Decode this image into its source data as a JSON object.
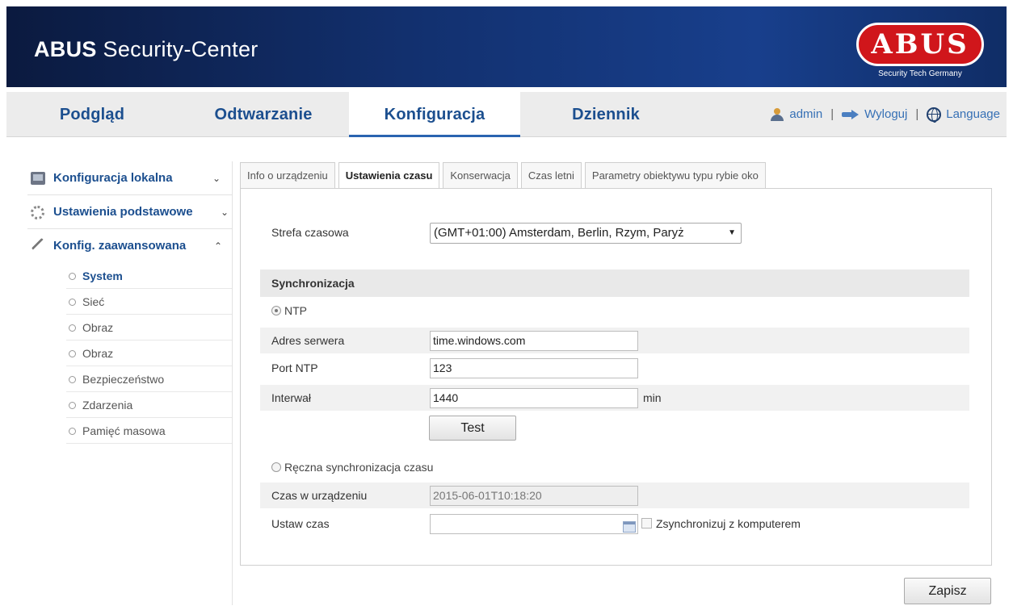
{
  "header": {
    "title_bold": "ABUS",
    "title_rest": " Security-Center",
    "logo_text": "ABUS",
    "logo_tagline": "Security Tech Germany"
  },
  "nav": {
    "tabs": [
      "Podgląd",
      "Odtwarzanie",
      "Konfiguracja",
      "Dziennik"
    ],
    "active_index": 2,
    "user": "admin",
    "logout": "Wyloguj",
    "language": "Language",
    "separator": "|"
  },
  "sidebar": {
    "items": [
      {
        "label": "Konfiguracja lokalna",
        "chevron": "⌄"
      },
      {
        "label": "Ustawienia podstawowe",
        "chevron": "⌄"
      },
      {
        "label": "Konfig. zaawansowana",
        "chevron": "⌃"
      }
    ],
    "subitems": [
      "System",
      "Sieć",
      "Obraz",
      "Obraz",
      "Bezpieczeństwo",
      "Zdarzenia",
      "Pamięć masowa"
    ],
    "active_sub": 0
  },
  "tabs": [
    "Info o urządzeniu",
    "Ustawienia czasu",
    "Konserwacja",
    "Czas letni",
    "Parametry obiektywu typu rybie oko"
  ],
  "active_tab": 1,
  "form": {
    "timezone_label": "Strefa czasowa",
    "timezone_value": "(GMT+01:00) Amsterdam, Berlin, Rzym, Paryż",
    "sync_header": "Synchronizacja",
    "ntp_label": "NTP",
    "server_label": "Adres serwera",
    "server_value": "time.windows.com",
    "port_label": "Port NTP",
    "port_value": "123",
    "interval_label": "Interwał",
    "interval_value": "1440",
    "interval_unit": "min",
    "test_button": "Test",
    "manual_label": "Ręczna synchronizacja czasu",
    "device_time_label": "Czas w urządzeniu",
    "device_time_value": "2015-06-01T10:18:20",
    "set_time_label": "Ustaw czas",
    "set_time_value": "",
    "sync_pc_label": "Zsynchronizuj z komputerem"
  },
  "save_button": "Zapisz",
  "colors": {
    "brand_red": "#d0161b",
    "nav_blue": "#1c4f8f",
    "header_navy": "#12306e"
  }
}
